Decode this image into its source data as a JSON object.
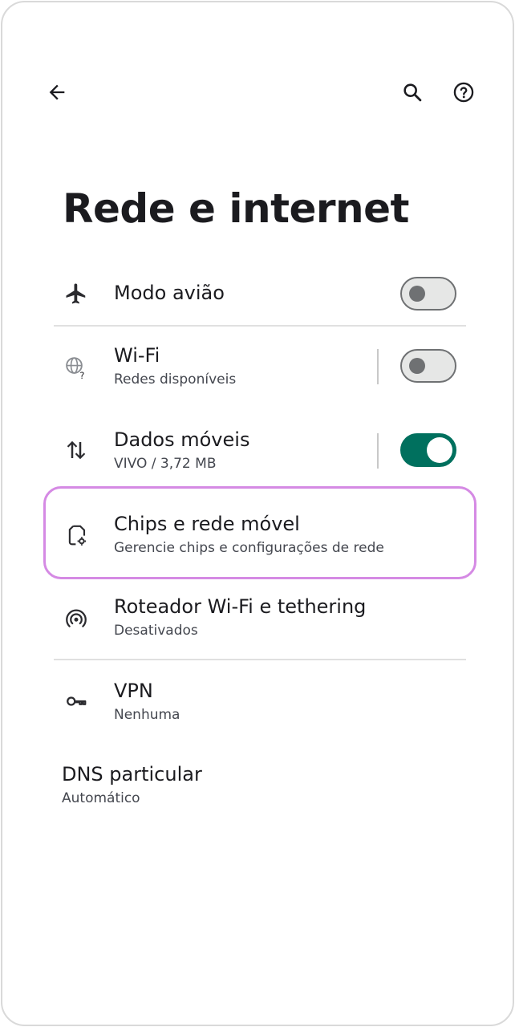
{
  "header": {
    "back_icon": "arrow-left-icon",
    "search_icon": "search-icon",
    "help_icon": "help-icon"
  },
  "page": {
    "title": "Rede e internet"
  },
  "items": [
    {
      "id": "airplane",
      "icon": "airplane-icon",
      "label": "Modo avião",
      "toggle": "off"
    },
    {
      "id": "wifi",
      "icon": "wifi-globe-icon",
      "label": "Wi-Fi",
      "sub": "Redes disponíveis",
      "toggle": "off"
    },
    {
      "id": "mobile-data",
      "icon": "data-arrows-icon",
      "label": "Dados móveis",
      "sub": "VIVO / 3,72 MB",
      "toggle": "on"
    },
    {
      "id": "sims",
      "icon": "sim-gear-icon",
      "label": "Chips e rede móvel",
      "sub": "Gerencie chips e configurações de rede",
      "highlight_color": "#d58ae4"
    },
    {
      "id": "hotspot",
      "icon": "hotspot-icon",
      "label": "Roteador Wi-Fi e tethering",
      "sub": "Desativados"
    },
    {
      "id": "vpn",
      "icon": "key-icon",
      "label": "VPN",
      "sub": "Nenhuma"
    },
    {
      "id": "dns",
      "label": "DNS particular",
      "sub": "Automático"
    }
  ],
  "colors": {
    "accent": "#00705e",
    "highlight": "#d58ae4",
    "text": "#1b1b1f"
  }
}
